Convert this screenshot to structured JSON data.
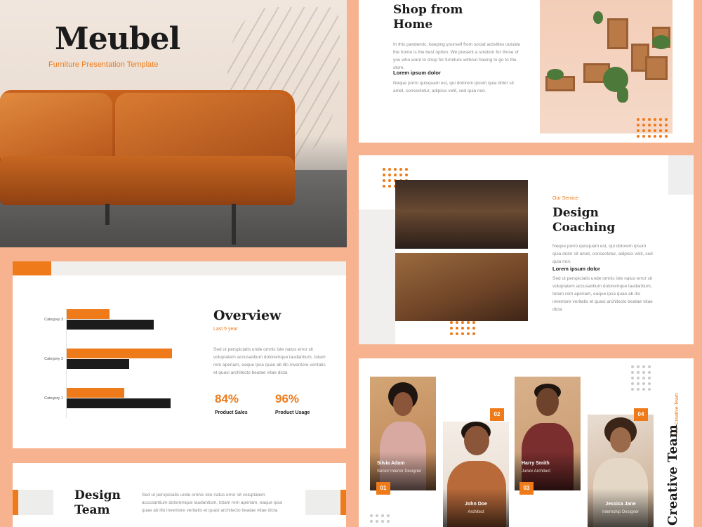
{
  "slide_cover": {
    "title": "Meubel",
    "subtitle": "Furniture Presentation Template"
  },
  "slide_shop": {
    "title": "Shop from Home",
    "body": "In this pandemic, keeping yourself from social activities outside the home is the best option. We present a solution for those of you who want to shop for furniture without having to go to the store.",
    "subheading": "Lorem ipsum dolor",
    "body2": "Neque porro quisquam est, qui dolorem ipsum quia dolor sit amet, consectetur, adipisci velit, sed quia non."
  },
  "slide_service": {
    "eyebrow": "Our Service",
    "title": "Design Coaching",
    "body": "Neque porro quisquam est, qui dolorem ipsum quia dolor sit amet, consectetur, adipisci velit, sed quia non.",
    "subheading": "Lorem ipsum dolor",
    "body2": "Sed ut perspiciatis unde omnis iste natus error sit voluptatem accusantium doloremque laudantium, totam rem aperiam, eaque ipsa quae ab illo inventore veritatis et quasi architecto beatae vitae dicta"
  },
  "slide_overview": {
    "title": "Overview",
    "subtitle": "Last 5 year",
    "body": "Sed ut perspiciatis unde omnis iste natus error sit voluptatem accusantium doloremque laudantium, totam rem aperiam, eaque ipsa quae ab illo inventore veritatis et quasi architecto beatae vitae dicta",
    "stats": [
      {
        "value": "84%",
        "label": "Product Sales"
      },
      {
        "value": "96%",
        "label": "Product Usage"
      }
    ],
    "chart_data": {
      "type": "bar",
      "orientation": "horizontal",
      "categories": [
        "Category 3",
        "Category 2",
        "Category 1"
      ],
      "series": [
        {
          "color": "#ef7a1a",
          "values": [
            2.6,
            6.4,
            3.5
          ]
        },
        {
          "color": "#1b1b1b",
          "values": [
            5.3,
            3.8,
            6.3
          ]
        }
      ],
      "xlim": [
        0,
        7
      ],
      "grid": false
    }
  },
  "slide_design_team": {
    "title": "Design Team",
    "body": "Sed ut perspiciatis unde omnis iste natus error sit voluptatem accusantium doloremque laudantium, totam rem aperiam, eaque ipsa quae ab illo inventore veritatis et quasi architecto beatae vitae dicta"
  },
  "slide_team": {
    "eyebrow": "Our Creative Team",
    "title": "Creative Team",
    "members": [
      {
        "number": "01",
        "name": "Silvia Adam",
        "role": "Senior Interior Designer"
      },
      {
        "number": "02",
        "name": "John Doe",
        "role": "Architect"
      },
      {
        "number": "03",
        "name": "Harry Smith",
        "role": "Junior Architect"
      },
      {
        "number": "04",
        "name": "Jessica Jane",
        "role": "Internship Designer"
      }
    ]
  },
  "colors": {
    "accent": "#ef7a1a",
    "background": "#f7b38f",
    "dark": "#1b1b1b"
  }
}
